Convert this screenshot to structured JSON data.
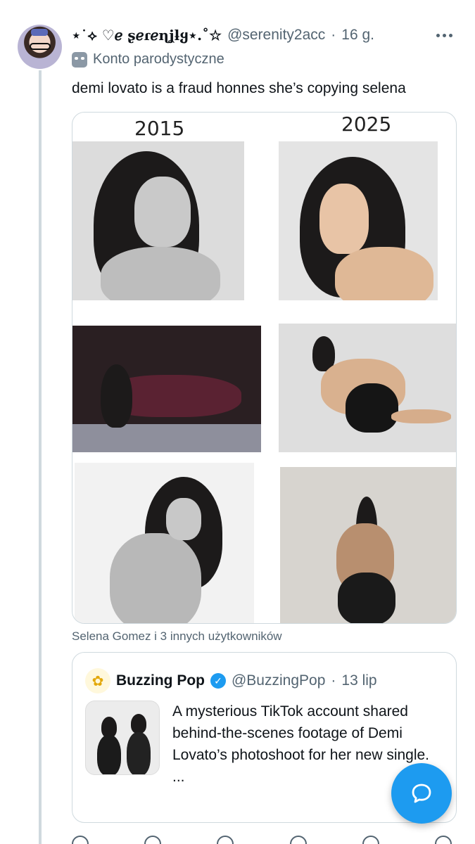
{
  "tweet": {
    "author_name": "⋆˙⟡ ♡ℯ ʂℯɾℯɳʝƚყ⋆.˚☆",
    "handle": "@serenity2acc",
    "separator": "·",
    "time": "16 g.",
    "parody_label": "Konto parodystyczne",
    "text": "demi lovato is a fraud honnes she’s copying selena",
    "media": {
      "year_left": "2015",
      "year_right": "2025"
    },
    "tagged": "Selena Gomez i 3 innych użytkowników"
  },
  "quote": {
    "author_name": "Buzzing Pop",
    "handle": "@BuzzingPop",
    "separator": "·",
    "time": "13 lip",
    "text": "A mysterious TikTok account shared behind-the-scenes footage of Demi Lovato’s photoshoot for her new single.",
    "ellipsis": "..."
  },
  "icons": {
    "more": "more-icon",
    "parody": "mask-icon",
    "verified": "verified-icon",
    "compose": "chat-bubble-icon"
  },
  "colors": {
    "accent": "#1d9bf0",
    "secondary_text": "#536471",
    "border": "#cfd9de"
  }
}
